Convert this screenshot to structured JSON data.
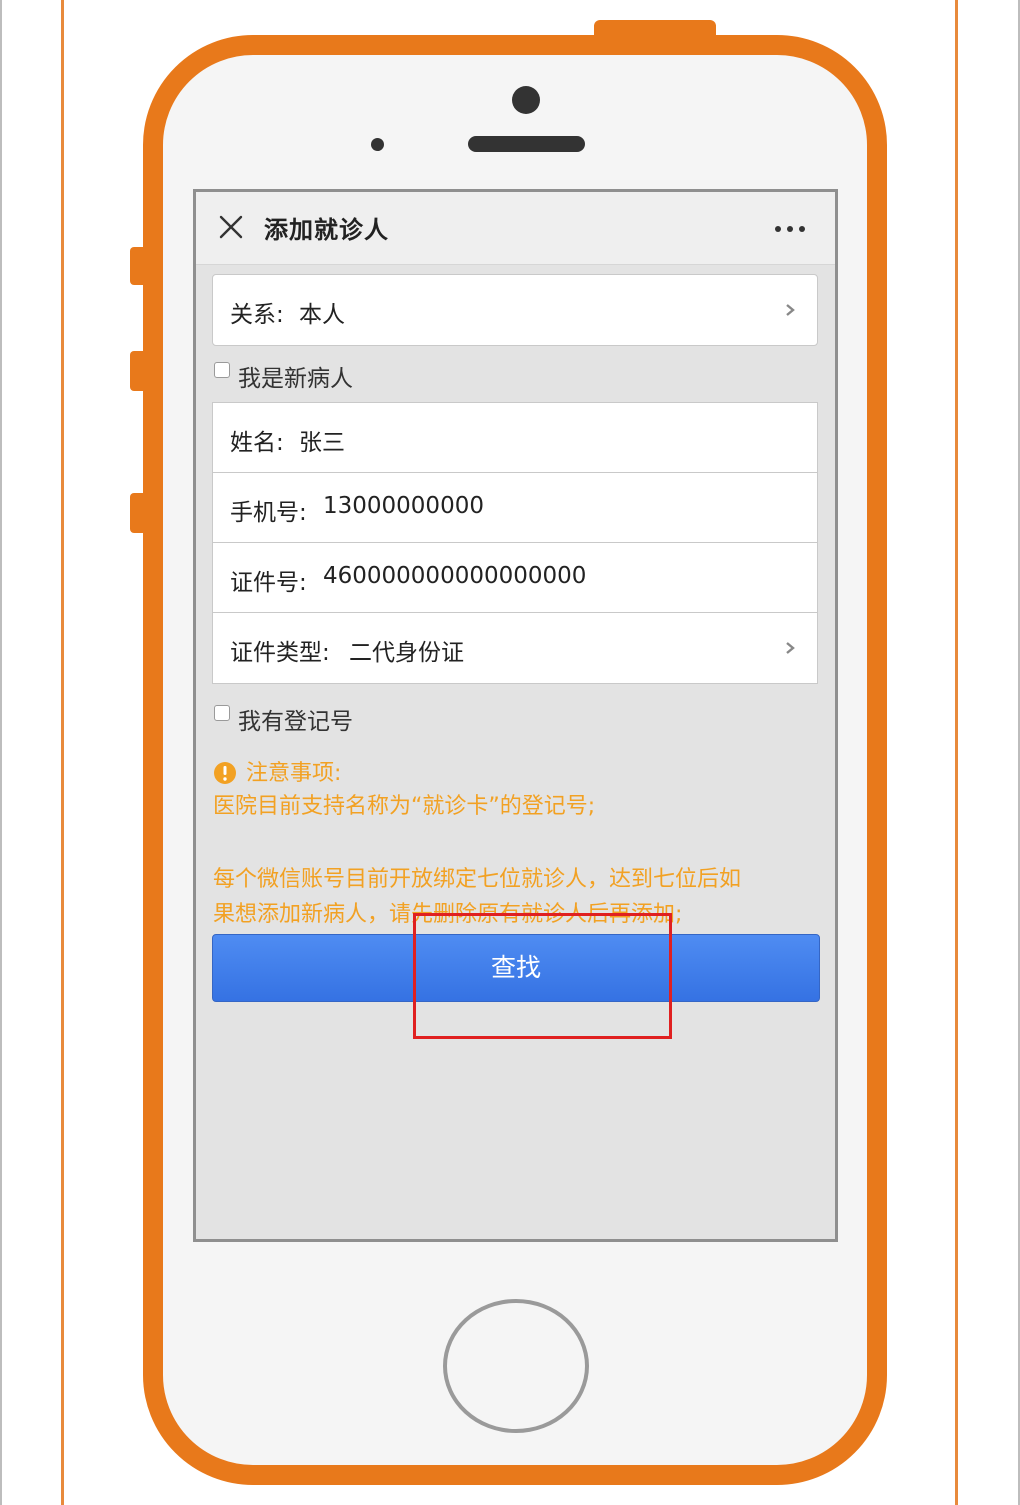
{
  "header": {
    "title": "添加就诊人"
  },
  "form": {
    "relation": {
      "label": "关系:",
      "value": "本人"
    },
    "new_patient_checkbox": {
      "label": "我是新病人",
      "checked": false
    },
    "name": {
      "label": "姓名:",
      "value": "张三"
    },
    "phone": {
      "label": "手机号:",
      "value": "13000000000"
    },
    "id_number": {
      "label": "证件号:",
      "value": "460000000000000000"
    },
    "id_type": {
      "label": "证件类型:",
      "value": "二代身份证"
    },
    "registration_checkbox": {
      "label": "我有登记号",
      "checked": false
    }
  },
  "notice": {
    "title": "注意事项:",
    "line1": "医院目前支持名称为“就诊卡”的登记号;",
    "line2": "每个微信账号目前开放绑定七位就诊人，达到七位后如",
    "line3": "果想添加新病人，请先删除原有就诊人后再添加;"
  },
  "actions": {
    "search_label": "查找"
  },
  "icons": {
    "close": "close-icon",
    "more": "more-icon",
    "chevron": "chevron-right-icon",
    "warning": "warning-icon"
  },
  "colors": {
    "phone_frame": "#e8791b",
    "notice_text": "#f2a123",
    "button": "#3f7ded",
    "highlight": "#e02020"
  }
}
